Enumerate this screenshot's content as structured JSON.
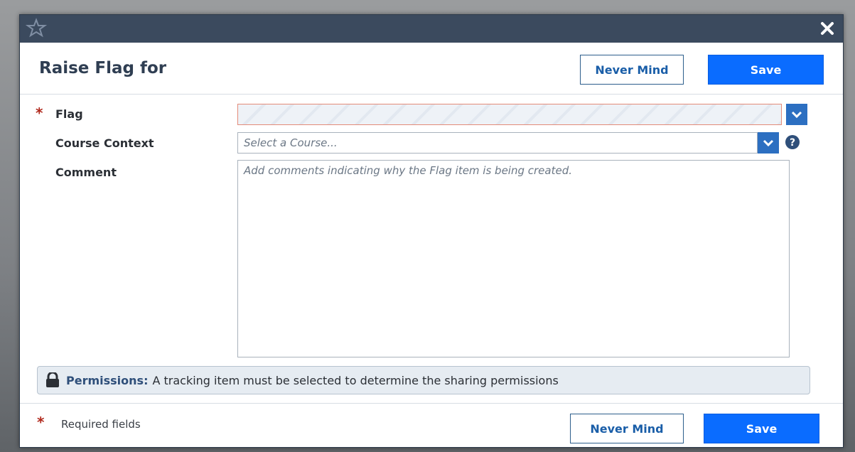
{
  "dialog": {
    "title": "Raise Flag for"
  },
  "header": {
    "never_mind_label": "Never Mind",
    "save_label": "Save"
  },
  "form": {
    "flag": {
      "label": "Flag",
      "required_marker": "*",
      "value": ""
    },
    "course_context": {
      "label": "Course Context",
      "placeholder": "Select a Course..."
    },
    "comment": {
      "label": "Comment",
      "placeholder": "Add comments indicating why the Flag item is being created."
    }
  },
  "permissions": {
    "label": "Permissions:",
    "text": "A tracking item must be selected to determine the sharing permissions",
    "icon": "lock-icon"
  },
  "footer": {
    "required_marker": "*",
    "required_note": "Required fields",
    "never_mind_label": "Never Mind",
    "save_label": "Save"
  },
  "colors": {
    "titlebar": "#3b4a5e",
    "primary_button": "#0a6cff",
    "dropdown_button": "#2c6fc1",
    "required_star": "#b0281c",
    "flag_field_border": "#e38b79"
  }
}
